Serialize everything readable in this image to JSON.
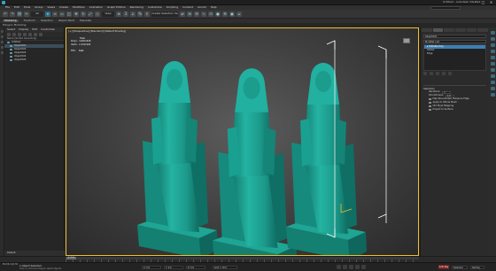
{
  "window": {
    "title": "Untitled - Autodesk 3ds Max",
    "controls": [
      "–",
      "□",
      "✕"
    ]
  },
  "menubar": {
    "items": [
      "File",
      "Edit",
      "Tools",
      "Group",
      "Views",
      "Create",
      "Modifiers",
      "Animation",
      "Graph Editors",
      "Rendering",
      "Customize",
      "Scripting",
      "Content",
      "Arnold",
      "Help"
    ]
  },
  "toolbar": {
    "selection_dropdown": "All",
    "view_dropdown": "View",
    "selection_set_dropdown": "Create Selection Se"
  },
  "ribbon": {
    "tabs": [
      "Modeling",
      "Freeform",
      "Selection",
      "Object Paint",
      "Populate"
    ],
    "active_tab": "Modeling",
    "sub_label": "Polygon Modeling"
  },
  "scene_explorer": {
    "tabs": [
      "Select",
      "Display",
      "Edit",
      "Customize"
    ],
    "column_header": "Name (Sorted Ascending)",
    "rows": [
      {
        "label": "Untitled",
        "level": 0,
        "selected": false
      },
      {
        "label": "Object001",
        "level": 1,
        "selected": true
      },
      {
        "label": "Object002",
        "level": 1,
        "selected": false
      },
      {
        "label": "Object003",
        "level": 1,
        "selected": false
      },
      {
        "label": "Object004",
        "level": 1,
        "selected": false
      },
      {
        "label": "Object005",
        "level": 1,
        "selected": false
      }
    ],
    "footer_label": "Default"
  },
  "viewport": {
    "label": "[+] [Perspective] [Standard] [Default Shading]",
    "stats": "            Total\nPolys:  4,660,828\nVerts:  2,340,920\n\nFPS:    NaN"
  },
  "command_panel": {
    "object_name": "Object001",
    "modifier_list": "Modifier List",
    "stack": [
      {
        "label": "▸ Editable Poly",
        "selected": true
      },
      {
        "label": "   Vertex",
        "selected": false
      },
      {
        "label": "   Edge",
        "selected": false
      }
    ],
    "rollout_title": "Selection",
    "params": [
      {
        "label": "Iterations:",
        "value": "1",
        "type": "spinner"
      },
      {
        "label": "Smoothness:",
        "value": "1.0",
        "type": "spinner"
      },
      {
        "label": "Map Boundaries: Preserve Edge",
        "type": "checkbox",
        "checked": true
      },
      {
        "label": "Apply to Whole Mesh",
        "type": "checkbox",
        "checked": false
      },
      {
        "label": "Old Style Mapping",
        "type": "checkbox",
        "checked": false
      },
      {
        "label": "Project to Surface",
        "type": "checkbox",
        "checked": false
      }
    ]
  },
  "timeline": {
    "frame_label": "0 / 100"
  },
  "status": {
    "script_label": "MAXScript Mi",
    "selection": "1 Object Selected",
    "prompt": "Click or click-and-drag to select objects",
    "x": "X: 0.0",
    "y": "Y: 0.0",
    "z": "Z: 0.0",
    "grid": "Grid = 10.0",
    "autokey": "Auto Key",
    "selected_label": "Selected",
    "set_key": "Set Key"
  },
  "colors": {
    "model": "#1fa595",
    "active_border": "#f0c02a",
    "accent": "#2aa7c7"
  }
}
